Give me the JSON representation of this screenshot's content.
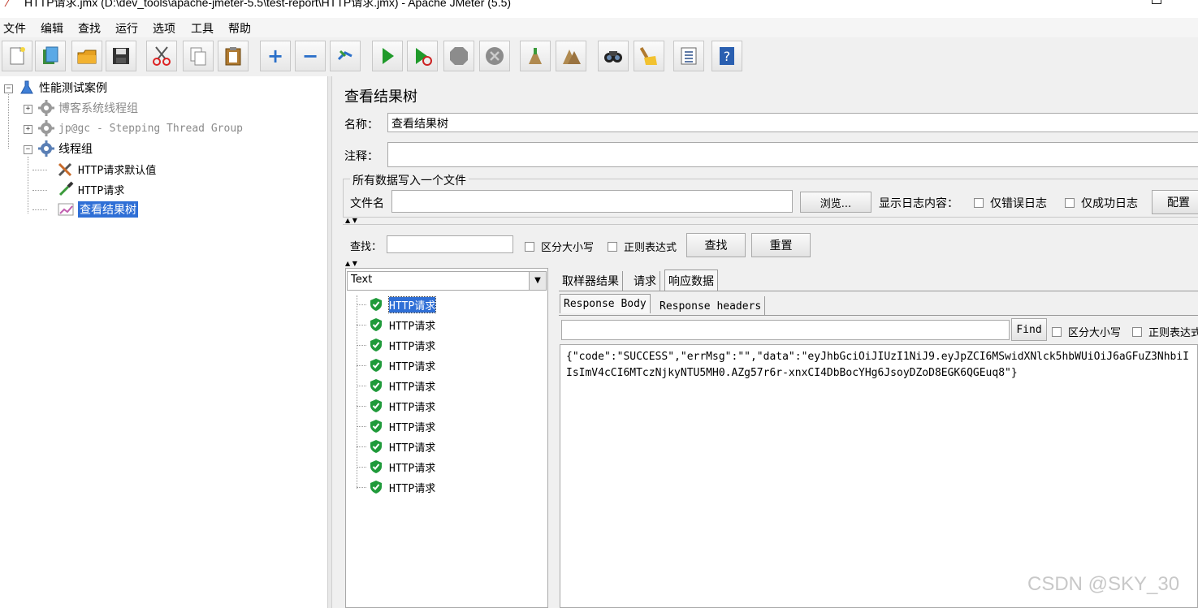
{
  "window": {
    "title": "HTTP请求.jmx (D:\\dev_tools\\apache-jmeter-5.5\\test-report\\HTTP请求.jmx) - Apache JMeter (5.5)"
  },
  "menu": [
    "文件",
    "编辑",
    "查找",
    "运行",
    "选项",
    "工具",
    "帮助"
  ],
  "toolbar_icons": [
    "new-icon",
    "templates-icon",
    "open-icon",
    "save-icon",
    "cut-icon",
    "copy-icon",
    "paste-icon",
    "expand-icon",
    "collapse-icon",
    "toggle-icon",
    "start-icon",
    "start-no-pause-icon",
    "stop-icon",
    "shutdown-icon",
    "clear-icon",
    "clear-all-icon",
    "search-icon",
    "reset-search-icon",
    "function-helper-icon",
    "help-icon"
  ],
  "tree": {
    "root": "性能测试案例",
    "items": [
      {
        "label": "博客系统线程组",
        "disabled": true
      },
      {
        "label": "jp@gc - Stepping Thread Group",
        "disabled": true
      },
      {
        "label": "线程组",
        "disabled": false
      },
      {
        "label": "HTTP请求默认值"
      },
      {
        "label": "HTTP请求"
      },
      {
        "label": "查看结果树",
        "selected": true
      }
    ]
  },
  "panel": {
    "title": "查看结果树",
    "name_label": "名称：",
    "name_value": "查看结果树",
    "comment_label": "注释：",
    "comment_value": "",
    "file_group_label": "所有数据写入一个文件",
    "filename_label": "文件名",
    "filename_value": "",
    "browse_button": "浏览...",
    "log_label": "显示日志内容：",
    "errors_only": "仅错误日志",
    "success_only": "仅成功日志",
    "configure_button": "配置"
  },
  "search": {
    "label": "查找：",
    "value": "",
    "case_sensitive": "区分大小写",
    "regex": "正则表达式",
    "find_button": "查找",
    "reset_button": "重置"
  },
  "results": {
    "renderer": "Text",
    "items": [
      "HTTP请求",
      "HTTP请求",
      "HTTP请求",
      "HTTP请求",
      "HTTP请求",
      "HTTP请求",
      "HTTP请求",
      "HTTP请求",
      "HTTP请求",
      "HTTP请求"
    ]
  },
  "tabs": {
    "main": [
      "取样器结果",
      "请求",
      "响应数据"
    ],
    "sub": [
      "Response Body",
      "Response headers"
    ]
  },
  "response": {
    "find_value": "",
    "find_button": "Find",
    "case_sensitive": "区分大小写",
    "regex": "正则表达式",
    "body_line1": "{\"code\":\"SUCCESS\",\"errMsg\":\"\",\"data\":\"eyJhbGciOiJIUzI1NiJ9.eyJpZCI6MSwidXNlck5hbWUiOiJ6aGFuZ3NhbiI",
    "body_line2": "IsImV4cCI6MTczNjkyNTU5MH0.AZg57r6r-xnxCI4DbBocYHg6JsoyDZoD8EGK6QGEuq8\"}"
  },
  "watermark": "CSDN @SKY_30"
}
